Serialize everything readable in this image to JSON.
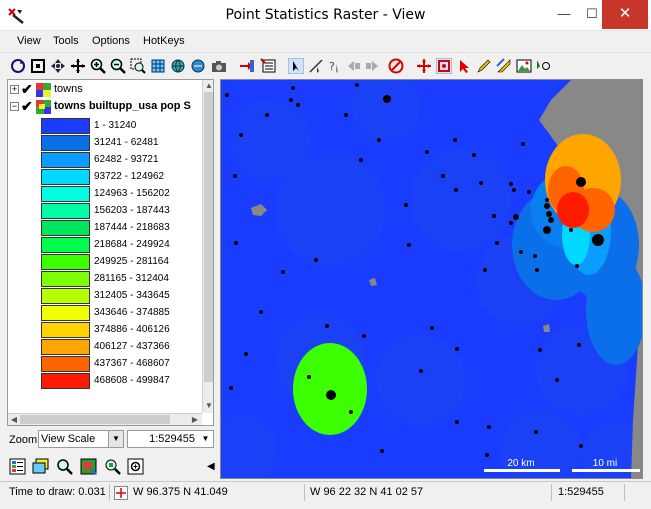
{
  "window": {
    "title": "Point Statistics Raster - View",
    "minimize": "—",
    "maximize": "☐",
    "close": "✕"
  },
  "menu": [
    "View",
    "Tools",
    "Options",
    "HotKeys"
  ],
  "layers": [
    {
      "label": "towns",
      "expander": "+"
    },
    {
      "label": "towns builtupp_usa pop S",
      "expander": "−"
    }
  ],
  "legend": [
    {
      "label": "1 - 31240",
      "color": "#1a3cff"
    },
    {
      "label": "31241 - 62481",
      "color": "#0a6fe8"
    },
    {
      "label": "62482 - 93721",
      "color": "#0a9dff"
    },
    {
      "label": "93722 - 124962",
      "color": "#00d8ff"
    },
    {
      "label": "124963 - 156202",
      "color": "#00ffe0"
    },
    {
      "label": "156203 - 187443",
      "color": "#00ffa5"
    },
    {
      "label": "187444 - 218683",
      "color": "#00e65c"
    },
    {
      "label": "218684 - 249924",
      "color": "#00ff4a"
    },
    {
      "label": "249925 - 281164",
      "color": "#3cff00"
    },
    {
      "label": "281165 - 312404",
      "color": "#7dff00"
    },
    {
      "label": "312405 - 343645",
      "color": "#b4ff00"
    },
    {
      "label": "343646 - 374885",
      "color": "#f0ff00"
    },
    {
      "label": "374886 - 406126",
      "color": "#ffd200"
    },
    {
      "label": "406127 - 437366",
      "color": "#ffa500"
    },
    {
      "label": "437367 - 468607",
      "color": "#ff6400"
    },
    {
      "label": "468608 - 499847",
      "color": "#ff1a00"
    }
  ],
  "zoom": {
    "label": "Zoom",
    "mode": "View Scale",
    "scale": "1:529455"
  },
  "map": {
    "scalebar_km": "20 km",
    "scalebar_mi": "10 mi"
  },
  "status": {
    "time_to_draw": "Time to draw: 0.031",
    "coords_decimal": "W 96.375  N 41.049",
    "coords_dms": "W 96 22 32  N 41 02 57",
    "scale": "1:529455"
  }
}
